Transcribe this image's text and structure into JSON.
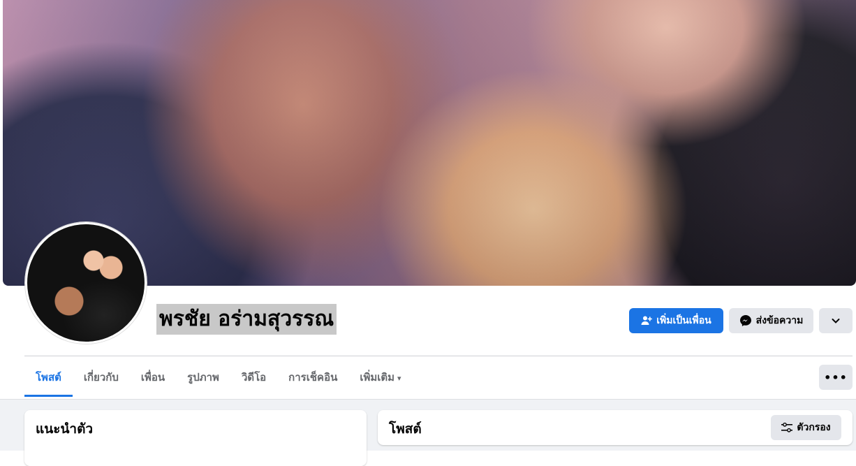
{
  "profile": {
    "name": "พรชัย อร่ามสุวรรณ"
  },
  "actions": {
    "add_friend": "เพิ่มเป็นเพื่อน",
    "message": "ส่งข้อความ",
    "more_icon": "chevron-down-icon"
  },
  "tabs": [
    {
      "label": "โพสต์",
      "active": true
    },
    {
      "label": "เกี่ยวกับ"
    },
    {
      "label": "เพื่อน"
    },
    {
      "label": "รูปภาพ"
    },
    {
      "label": "วิดีโอ"
    },
    {
      "label": "การเช็คอิน"
    },
    {
      "label": "เพิ่มเติม",
      "caret": "▾"
    }
  ],
  "tab_menu_label": "•••",
  "intro": {
    "title": "แนะนำตัว"
  },
  "posts": {
    "title": "โพสต์",
    "filter_label": "ตัวกรอง"
  },
  "colors": {
    "primary": "#1b74e4",
    "secondary_bg": "#e4e6eb",
    "page_bg": "#f0f2f5"
  }
}
